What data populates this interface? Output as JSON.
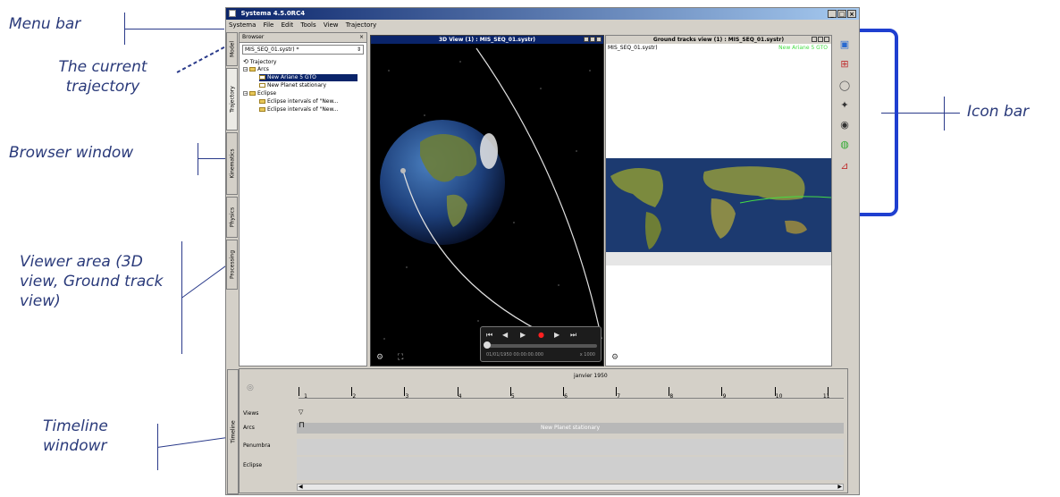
{
  "callouts": {
    "menu_bar": "Menu bar",
    "current_trajectory": "The current trajectory",
    "browser_window": "Browser window",
    "viewer_area": "Viewer area (3D view, Ground track view)",
    "timeline_window": "Timeline windowr",
    "icon_bar": "Icon bar"
  },
  "app": {
    "title": "Systema 4.5.0RC4",
    "menu": [
      "Systema",
      "File",
      "Edit",
      "Tools",
      "View",
      "Trajectory"
    ],
    "side_tabs": [
      "Model",
      "Trajectory",
      "Kinematics",
      "Physics",
      "Processing"
    ]
  },
  "browser": {
    "title": "Browser",
    "selector_value": "MIS_SEQ_01.systr) *",
    "tree": [
      {
        "label": "Trajectory",
        "level": 0,
        "type": "root"
      },
      {
        "label": "Arcs",
        "level": 1,
        "type": "folder"
      },
      {
        "label": "New Ariane 5 GTO",
        "level": 2,
        "type": "item",
        "selected": true
      },
      {
        "label": "New Planet stationary",
        "level": 2,
        "type": "item"
      },
      {
        "label": "Eclipse",
        "level": 1,
        "type": "folder"
      },
      {
        "label": "Eclipse intervals of \"New...",
        "level": 2,
        "type": "item"
      },
      {
        "label": "Eclipse intervals of \"New...",
        "level": 2,
        "type": "item"
      }
    ]
  },
  "view3d": {
    "title": "3D View (1) : MIS_SEQ_01.systr)",
    "time_display": "01/01/1950 00:00:00.000",
    "speed_display": "x 1000"
  },
  "ground_track": {
    "title": "Ground tracks view (1) : MIS_SEQ_01.systr)",
    "file_label": "MIS_SEQ_01.systr)",
    "legend_label": "New Ariane 5 GTO",
    "legend_color": "#44dd44"
  },
  "timeline": {
    "title": "Timeline",
    "header": "janvier 1950",
    "ticks": [
      "1",
      "2",
      "3",
      "4",
      "5",
      "6",
      "7",
      "8",
      "9",
      "10",
      "11"
    ],
    "rows": [
      "Views",
      "Arcs",
      "Penumbra",
      "Eclipse"
    ],
    "arc_bar_label": "New Planet stationary"
  },
  "colors": {
    "accent": "#0a246a",
    "callout_text": "#2a3a7a",
    "icon_bar_highlight": "#1f3fd0"
  },
  "icon_bar": [
    "layout-icon",
    "add-view-icon",
    "orbit-icon",
    "satellite-icon",
    "station-icon",
    "globe-icon",
    "chart-icon"
  ]
}
